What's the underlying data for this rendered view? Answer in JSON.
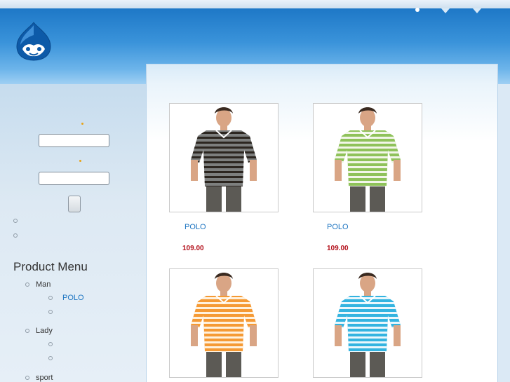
{
  "sidebar": {
    "menu_title": "Product Menu",
    "menu": [
      {
        "label": "Man",
        "children": [
          {
            "label": "POLO"
          },
          {
            "label": ""
          }
        ]
      },
      {
        "label": "Lady",
        "children": [
          {
            "label": ""
          },
          {
            "label": ""
          }
        ]
      },
      {
        "label": "sport",
        "children": []
      }
    ]
  },
  "products": [
    {
      "name": "POLO",
      "price": "109.00",
      "shirt_color": "#7d7f7e",
      "stripe_color": "#2c2620"
    },
    {
      "name": "POLO",
      "price": "109.00",
      "shirt_color": "#8fc25a",
      "stripe_color": "#f2f6e8"
    },
    {
      "name": "",
      "price": "",
      "shirt_color": "#f59a35",
      "stripe_color": "#fff1dd"
    },
    {
      "name": "",
      "price": "",
      "shirt_color": "#34b4e0",
      "stripe_color": "#eaf7fc"
    }
  ],
  "colors": {
    "header_blue": "#1e78c7",
    "link_blue": "#1f76c2",
    "price_red": "#b3101b"
  }
}
